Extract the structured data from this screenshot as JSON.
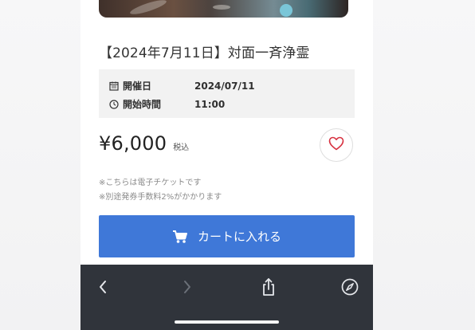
{
  "event": {
    "title": "【2024年7月11日】対面一斉浄霊",
    "date_label": "開催日",
    "date_value": "2024/07/11",
    "time_label": "開始時間",
    "time_value": "11:00"
  },
  "price": {
    "amount": "¥6,000",
    "tax_label": "税込"
  },
  "notes": [
    "※こちらは電子チケットです",
    "※別途発券手数料2%がかかります"
  ],
  "cart_button": {
    "label": "カートに入れる"
  },
  "toolbar": {
    "icons": [
      "back-icon",
      "forward-icon",
      "share-icon",
      "compass-icon"
    ]
  },
  "colors": {
    "accent": "#3f78d8",
    "favorite_heart": "#d7303f",
    "toolbar_bg": "#30343b"
  }
}
